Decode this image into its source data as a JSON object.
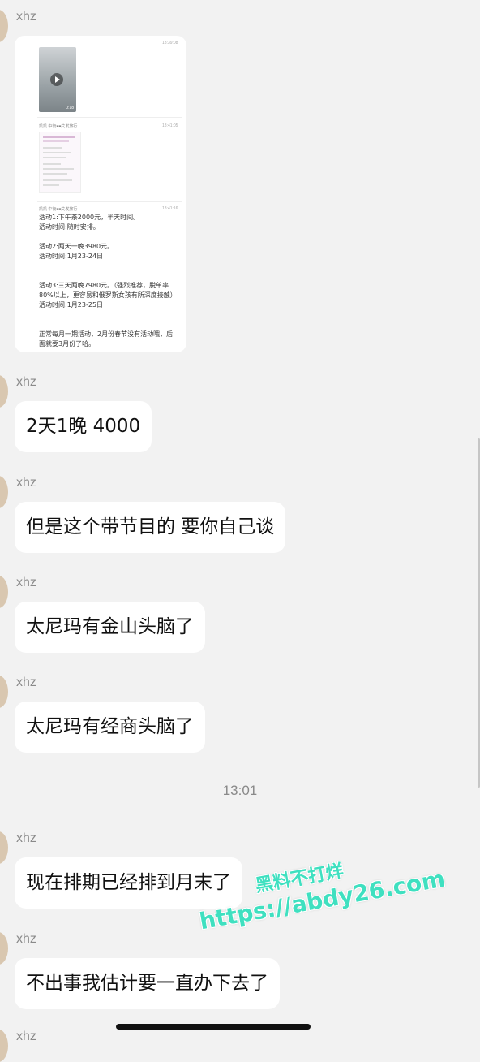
{
  "messages": [
    {
      "sender": "xhz"
    },
    {
      "sender": "xhz",
      "text": "2天1晚 4000"
    },
    {
      "sender": "xhz",
      "text": "但是这个带节目的 要你自己谈"
    },
    {
      "sender": "xhz",
      "text": "太尼玛有金山头脑了"
    },
    {
      "sender": "xhz",
      "text": "太尼玛有经商头脑了"
    },
    {
      "sender": "xhz",
      "text": "现在排期已经排到月末了"
    },
    {
      "sender": "xhz",
      "text": "不出事我估计要一直办下去了"
    },
    {
      "sender": "xhz"
    }
  ],
  "timestamp": "13:01",
  "screenshot_card": {
    "ts1": "18:39:08",
    "ts2": "18:41:05",
    "ts3": "18:41:16",
    "video_duration": "0:18",
    "sender_line_1": "凯凯 中衡■■艾发旅行",
    "sender_line_2": "凯凯 中衡■■艾发旅行",
    "activity_text": "活动1:下午茶2000元，半天时间。\n活动时间:随时安排。\n\n活动2:两天一晚3980元。\n活动时间:1月23-24日\n\n\n活动3:三天两晚7980元。（强烈推荐，脱单率\n80%以上，更容易和俄罗斯女孩有所深度接触）\n活动时间:1月23-25日\n\n\n正常每月一期活动，2月份春节没有活动哦，后\n面就要3月份了哈。"
  },
  "watermark": {
    "line1": "黑料不打烊",
    "line2": "https://abdy26.com"
  }
}
